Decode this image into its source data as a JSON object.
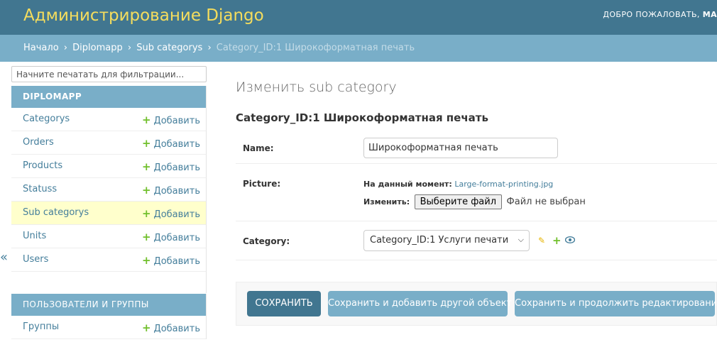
{
  "header": {
    "site_name": "Администрирование Django",
    "welcome": "ДОБРО ПОЖАЛОВАТЬ,",
    "user_fragment": "MA"
  },
  "breadcrumbs": {
    "items": [
      "Начало",
      "Diplomapp",
      "Sub categorys"
    ],
    "separator": "›",
    "current": "Category_ID:1 Широкоформатная печать"
  },
  "sidebar": {
    "filter_placeholder": "Начните печатать для фильтрации...",
    "toggle_label": "«",
    "modules": [
      {
        "caption": "DIPLOMAPP",
        "items": [
          {
            "label": "Categorys",
            "add": "Добавить"
          },
          {
            "label": "Orders",
            "add": "Добавить"
          },
          {
            "label": "Products",
            "add": "Добавить"
          },
          {
            "label": "Statuss",
            "add": "Добавить"
          },
          {
            "label": "Sub categorys",
            "add": "Добавить"
          },
          {
            "label": "Units",
            "add": "Добавить"
          },
          {
            "label": "Users",
            "add": "Добавить"
          }
        ]
      },
      {
        "caption": "ПОЛЬЗОВАТЕЛИ И ГРУППЫ",
        "items": [
          {
            "label": "Группы",
            "add": "Добавить"
          }
        ]
      }
    ],
    "add_symbol": "+"
  },
  "content": {
    "title": "Изменить sub category",
    "object_title": "Category_ID:1 Широкоформатная печать",
    "fields": {
      "name_label": "Name:",
      "name_value": "Широкоформатная печать",
      "picture_label": "Picture:",
      "current_label": "На данный момент:",
      "current_file": "Large-format-printing.jpg",
      "change_label": "Изменить:",
      "choose_file": "Выберите файл",
      "no_file": "Файл не выбран",
      "category_label": "Category:",
      "category_value": "Category_ID:1 Услуги печати"
    },
    "related_icons": [
      "pencil-icon",
      "plus-icon",
      "eye-icon"
    ],
    "buttons": {
      "save": "СОХРАНИТЬ",
      "save_add": "Сохранить и добавить другой объект",
      "save_continue": "Сохранить и продолжить редактирование"
    }
  },
  "colors": {
    "header_bg": "#417690",
    "brand": "#f5dd5d",
    "breadcrumbs_bg": "#79aec8",
    "link": "#447e9b",
    "add_plus": "#70bf2b",
    "current_row": "#ffffcc"
  }
}
